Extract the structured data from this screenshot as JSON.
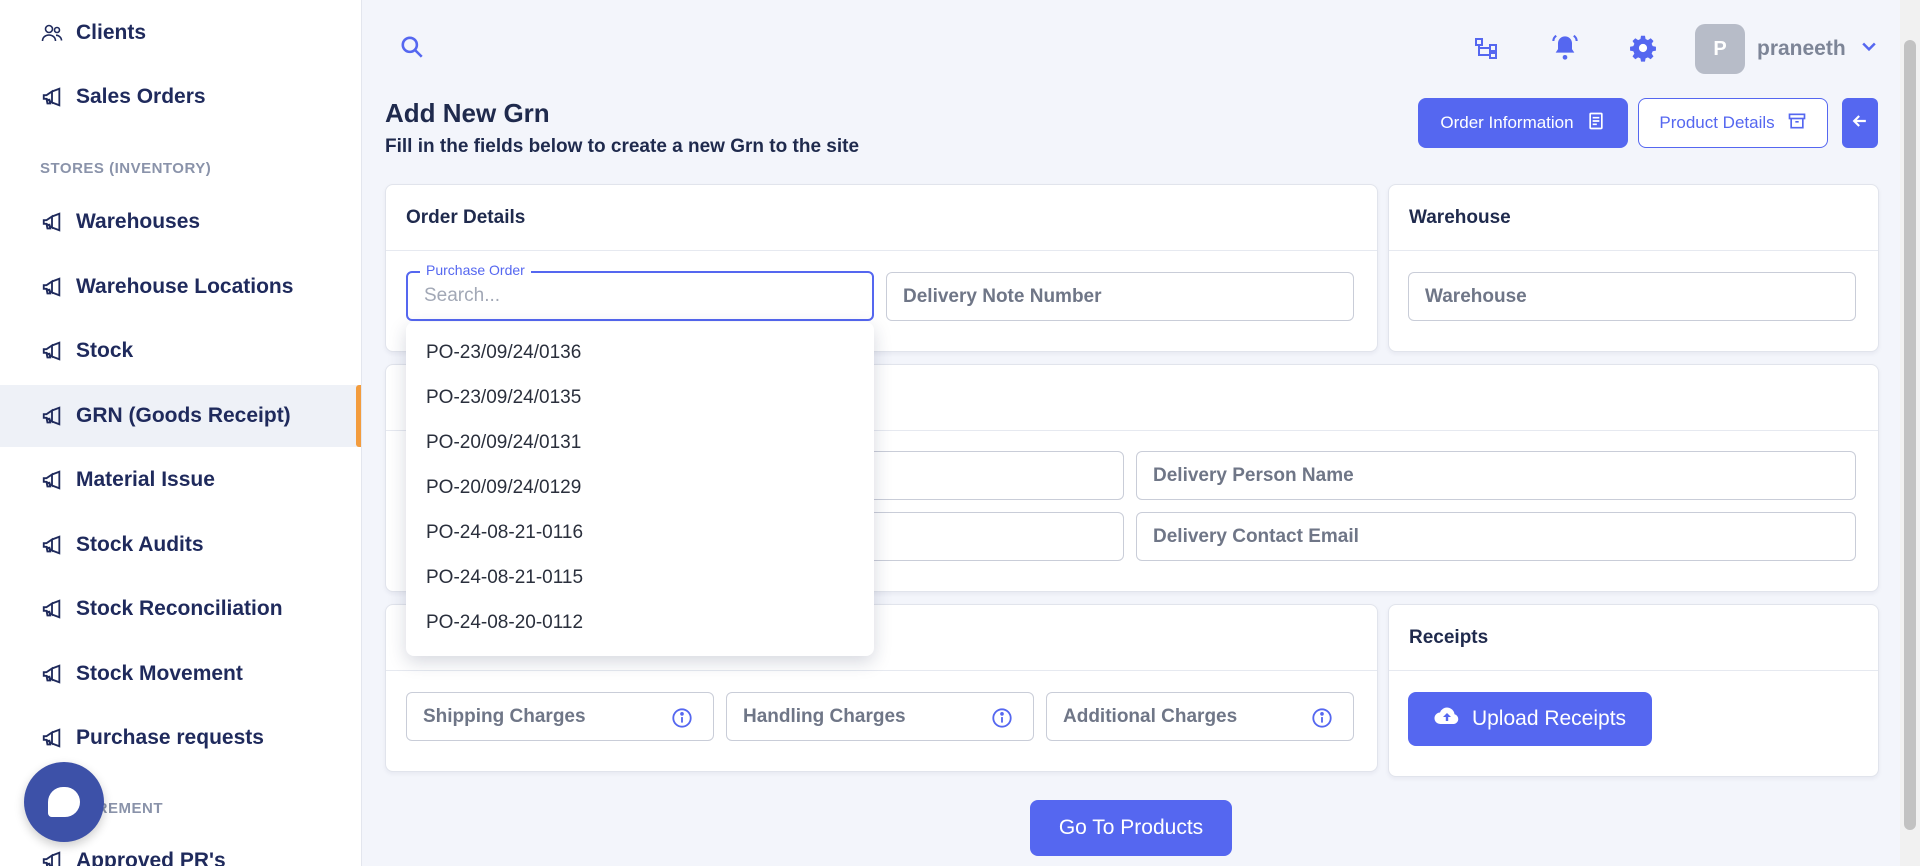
{
  "sidebar": {
    "items": [
      {
        "label": "Clients",
        "icon": "users-icon"
      },
      {
        "label": "Sales Orders",
        "icon": "megaphone-icon"
      },
      {
        "label": "Warehouses",
        "icon": "megaphone-icon"
      },
      {
        "label": "Warehouse Locations",
        "icon": "megaphone-icon"
      },
      {
        "label": "Stock",
        "icon": "megaphone-icon"
      },
      {
        "label": "GRN (Goods Receipt)",
        "icon": "megaphone-icon",
        "active": true
      },
      {
        "label": "Material Issue",
        "icon": "megaphone-icon"
      },
      {
        "label": "Stock Audits",
        "icon": "megaphone-icon"
      },
      {
        "label": "Stock Reconciliation",
        "icon": "megaphone-icon"
      },
      {
        "label": "Stock Movement",
        "icon": "megaphone-icon"
      },
      {
        "label": "Purchase requests",
        "icon": "megaphone-icon"
      },
      {
        "label": "Approved PR's",
        "icon": "megaphone-icon"
      }
    ],
    "sections": {
      "stores": "STORES (INVENTORY)",
      "procurement": "PROCUREMENT"
    }
  },
  "header": {
    "avatar_initial": "P",
    "username": "praneeth"
  },
  "page": {
    "title": "Add New Grn",
    "subtitle": "Fill in the fields below to create a new Grn to the site",
    "order_info_label": "Order Information",
    "product_details_label": "Product Details"
  },
  "order_details": {
    "title": "Order Details",
    "purchase_order_label": "Purchase Order",
    "purchase_order_placeholder": "Search...",
    "delivery_note_placeholder": "Delivery Note Number"
  },
  "warehouse": {
    "title": "Warehouse",
    "placeholder": "Warehouse"
  },
  "delivery": {
    "person_name_placeholder": "Delivery Person Name",
    "contact_email_placeholder": "Delivery Contact Email"
  },
  "charges": {
    "shipping": "Shipping Charges",
    "handling": "Handling Charges",
    "additional": "Additional Charges"
  },
  "receipts": {
    "title": "Receipts",
    "upload_label": "Upload Receipts"
  },
  "dropdown": {
    "options": [
      "PO-23/09/24/0136",
      "PO-23/09/24/0135",
      "PO-20/09/24/0131",
      "PO-20/09/24/0129",
      "PO-24-08-21-0116",
      "PO-24-08-21-0115",
      "PO-24-08-20-0112"
    ]
  },
  "footer": {
    "goto_label": "Go To Products"
  },
  "colors": {
    "accent": "#5567f0",
    "active_indicator": "#f39c3d",
    "navy": "#1f2a5c"
  }
}
